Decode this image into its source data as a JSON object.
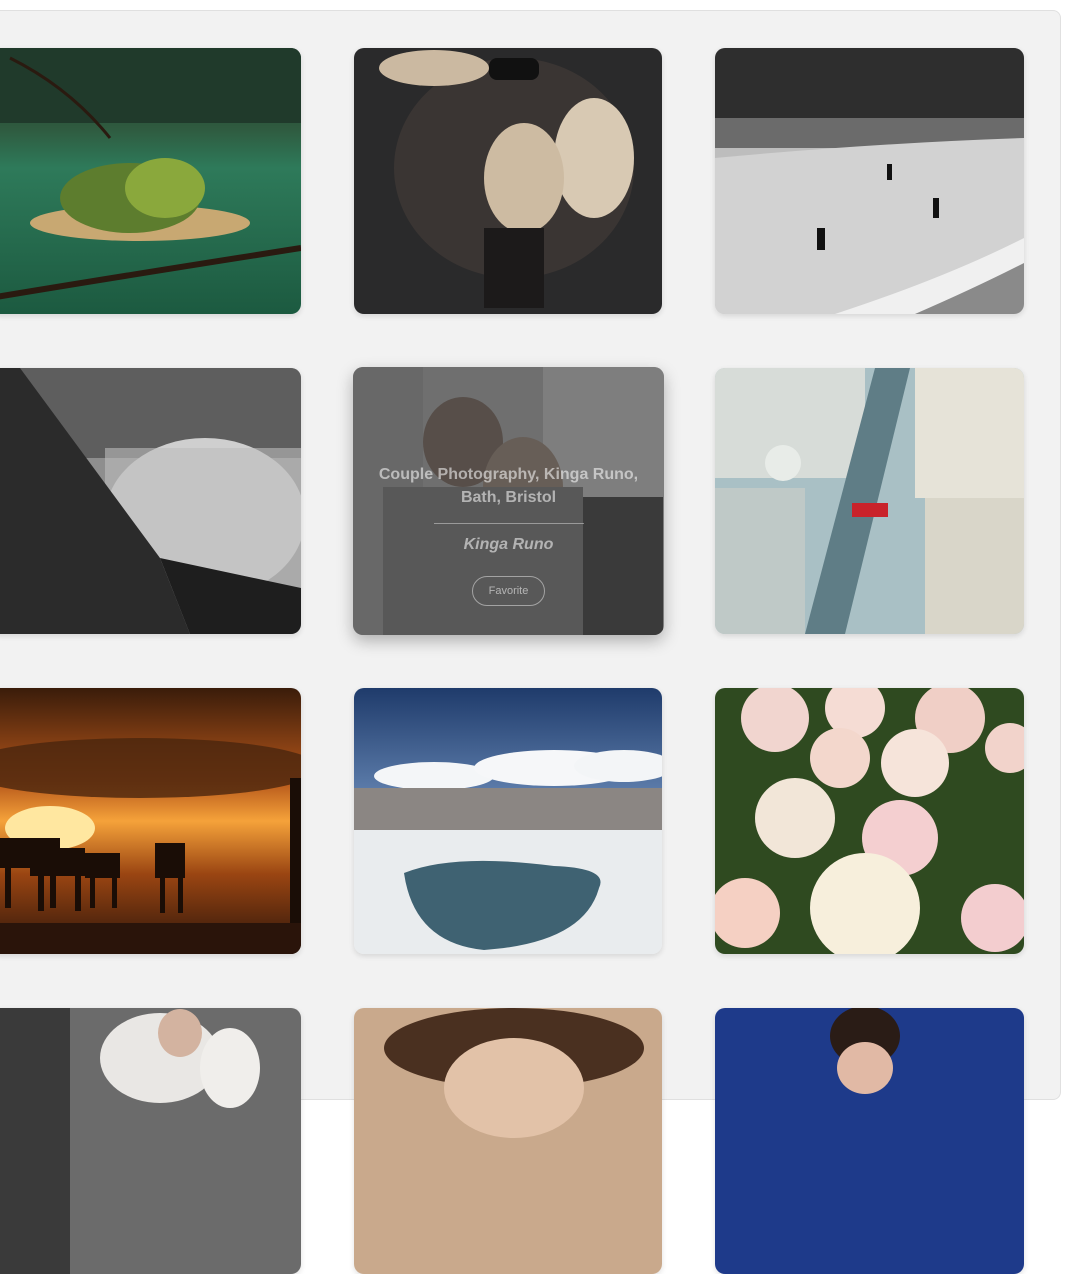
{
  "gallery": {
    "photos": [
      {
        "subject": "lake-island"
      },
      {
        "subject": "fur-coat-model"
      },
      {
        "subject": "beach-walkers"
      },
      {
        "subject": "fortress-wall"
      },
      {
        "subject": "couple",
        "hovered": true,
        "title": "Couple Photography, Kinga Runo, Bath, Bristol",
        "author": "Kinga Runo",
        "favorite_label": "Favorite"
      },
      {
        "subject": "city-aerial"
      },
      {
        "subject": "sunset-horse-riders"
      },
      {
        "subject": "salt-flat-pool"
      },
      {
        "subject": "peonies"
      },
      {
        "subject": "woman-white-coat"
      },
      {
        "subject": "curly-hair-portrait"
      },
      {
        "subject": "blue-sky-portrait"
      }
    ]
  },
  "colors": {
    "panel_background": "#f2f2f2",
    "page_background": "#ffffff"
  }
}
